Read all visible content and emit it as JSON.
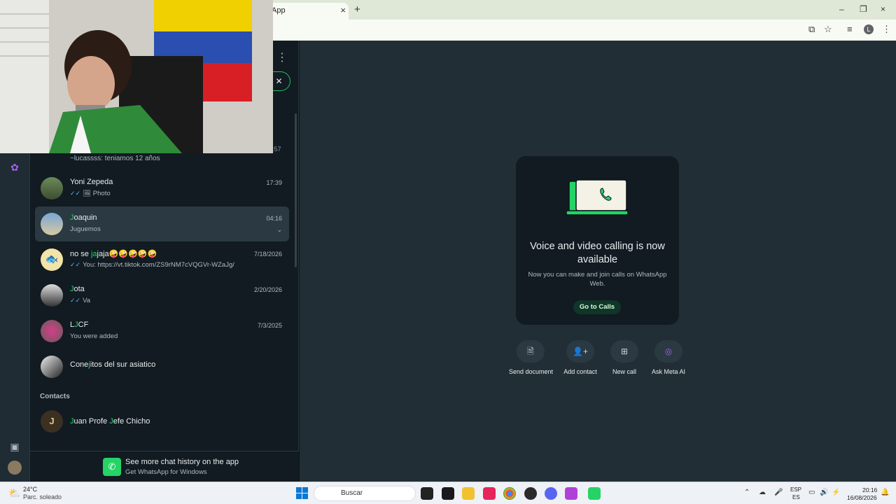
{
  "browser": {
    "tab_title": "App",
    "tab_close": "×",
    "new_tab": "+",
    "window_controls": [
      "–",
      "❐",
      "×"
    ],
    "toolbar_icons": [
      "install-icon",
      "bookmark-star-icon",
      "media-icon",
      "profile-avatar",
      "kebab-menu-icon"
    ],
    "profile_initial": "L"
  },
  "sidebar": {
    "menu_label": "⋮",
    "filter_close": "✕",
    "partial_chat_time": ":57",
    "partial_chat_preview": "~lucassss: teniamos 12 años",
    "chats": [
      {
        "name_hl": "",
        "name_rest": "Yoni Zepeda",
        "time": "17:39",
        "preview": "Photo",
        "tick": "✓✓",
        "photo_icon": "🖼"
      },
      {
        "name_hl": "J",
        "name_rest": "oaquin",
        "time": "04:16",
        "preview": "Juguemos",
        "tick": "",
        "caret": "⌄"
      },
      {
        "name_hl": "",
        "name_rest": "no se ",
        "name_hl2": "ja",
        "name_rest2": "jaja",
        "emoji": "🤪🤪🤪🤪🤪",
        "time": "7/18/2026",
        "preview": "You: https://vt.tiktok.com/ZS9rNM7cVQGVr-WZaJg/",
        "tick": "✓✓"
      },
      {
        "name_hl": "J",
        "name_rest": "ota",
        "time": "2/20/2026",
        "preview": "Va",
        "tick": "✓✓"
      },
      {
        "name_hl": "",
        "name_rest": "L",
        "name_hl2": "J",
        "name_rest2": "CF",
        "time": "7/3/2025",
        "preview": "You were added",
        "tick": ""
      },
      {
        "name_hl": "",
        "name_rest": "Cone",
        "name_hl2": "j",
        "name_rest2": "itos del sur asiatico",
        "time": "",
        "preview": "",
        "tick": ""
      }
    ],
    "contacts_header": "Contacts",
    "contact": {
      "initial": "J",
      "hl1": "J",
      "part1": "uan Profe ",
      "hl2": "J",
      "part2": "efe Chicho"
    },
    "banner_title": "See more chat history on the app",
    "banner_sub": "Get WhatsApp for Windows"
  },
  "main": {
    "card_title": "Voice and video calling is now available",
    "card_desc": "Now you can make and join calls on WhatsApp Web.",
    "card_button": "Go to Calls",
    "actions": [
      {
        "label": "Send document",
        "icon": "document-icon",
        "glyph": "🗎"
      },
      {
        "label": "Add contact",
        "icon": "add-contact-icon",
        "glyph": "👤+"
      },
      {
        "label": "New call",
        "icon": "video-call-icon",
        "glyph": "⊞"
      },
      {
        "label": "Ask Meta AI",
        "icon": "meta-ai-icon",
        "glyph": "◎"
      }
    ]
  },
  "taskbar": {
    "temp": "24°C",
    "weather": "Parc. soleado",
    "search_placeholder": "Buscar",
    "lang_top": "ESP",
    "lang_bottom": "ES",
    "time": "20:16",
    "date": "16/08/2026"
  },
  "colors": {
    "accent": "#25d366",
    "panel": "#111b21",
    "main_bg": "#222e35"
  }
}
